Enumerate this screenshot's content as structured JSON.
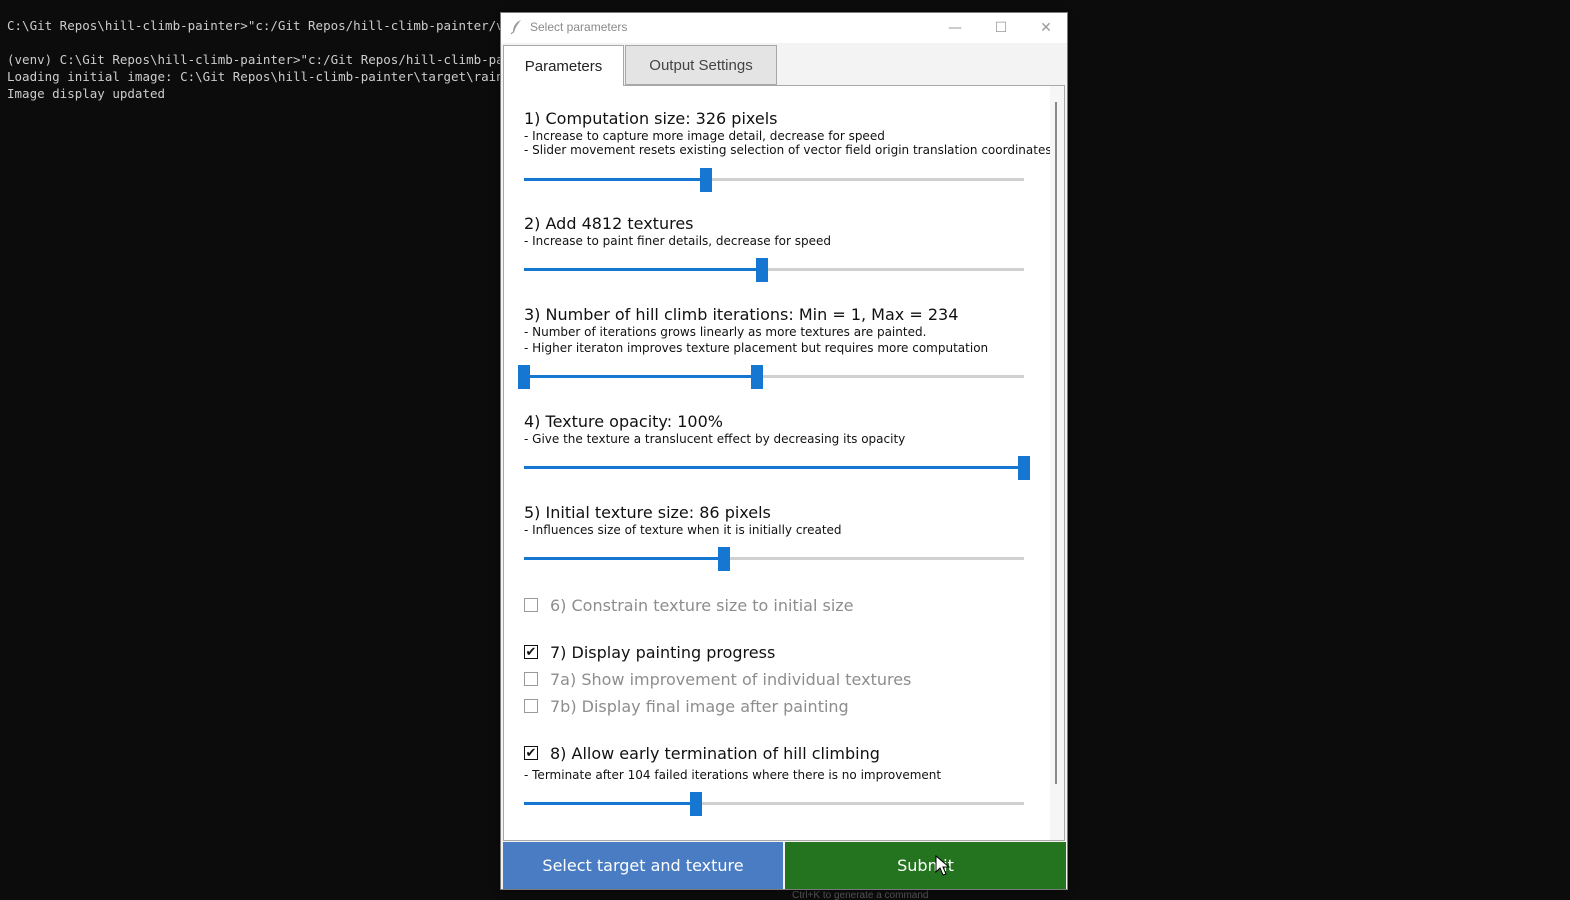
{
  "terminal": {
    "lines": [
      "C:\\Git Repos\\hill-climb-painter>\"c:/Git Repos/hill-climb-painter/venv/S",
      "",
      "(venv) C:\\Git Repos\\hill-climb-painter>\"c:/Git Repos/hill-climb-painter",
      "Loading initial image: C:\\Git Repos\\hill-climb-painter\\target\\rainy_ori",
      "Image display updated"
    ],
    "hint": "Ctrl+K to generate a command"
  },
  "window": {
    "title": "Select parameters",
    "controls": {
      "minimize": "—",
      "maximize": "☐",
      "close": "✕"
    }
  },
  "tabs": [
    {
      "label": "Parameters",
      "active": true
    },
    {
      "label": "Output Settings",
      "active": false
    }
  ],
  "settings": {
    "s1": {
      "heading": "1) Computation size: 326 pixels",
      "desc1": "- Increase to capture more image detail, decrease for speed",
      "desc2": "- Slider movement resets existing selection of vector field origin translation coordinates",
      "slider_fraction": 0.364
    },
    "s2": {
      "heading": "2) Add 4812 textures",
      "desc1": "- Increase to paint finer details, decrease for speed",
      "slider_fraction": 0.476
    },
    "s3": {
      "heading": "3) Number of hill climb iterations: Min = 1, Max = 234",
      "desc1": "- Number of iterations grows linearly as more textures are painted.",
      "desc2": "- Higher iteraton improves texture placement but requires more computation",
      "range_min_fraction": 0.0,
      "range_max_fraction": 0.466
    },
    "s4": {
      "heading": "4) Texture opacity: 100%",
      "desc1": "- Give the texture a translucent effect by decreasing its opacity",
      "slider_fraction": 1.0
    },
    "s5": {
      "heading": "5) Initial texture size: 86 pixels",
      "desc1": "- Influences size of texture when it is initially created",
      "slider_fraction": 0.4
    },
    "c6": {
      "label": "6) Constrain texture size to initial size",
      "checked": false,
      "enabled": false
    },
    "c7": {
      "label": "7) Display painting progress",
      "checked": true,
      "enabled": true
    },
    "c7a": {
      "label": "7a) Show improvement of individual textures",
      "checked": false,
      "enabled": false
    },
    "c7b": {
      "label": "7b) Display final image after painting",
      "checked": false,
      "enabled": false
    },
    "c8": {
      "label": "8) Allow early termination of hill climbing",
      "checked": true,
      "enabled": true,
      "desc1": "- Terminate after 104 failed iterations where there is no improvement",
      "slider_fraction": 0.344
    }
  },
  "buttons": {
    "select": "Select target and texture",
    "submit": "Submit"
  },
  "colors": {
    "accent": "#1677d2",
    "select_button": "#4a7cc4",
    "submit_button": "#24731f",
    "terminal_bg": "#0c0c0c"
  },
  "checkmark": "✔"
}
